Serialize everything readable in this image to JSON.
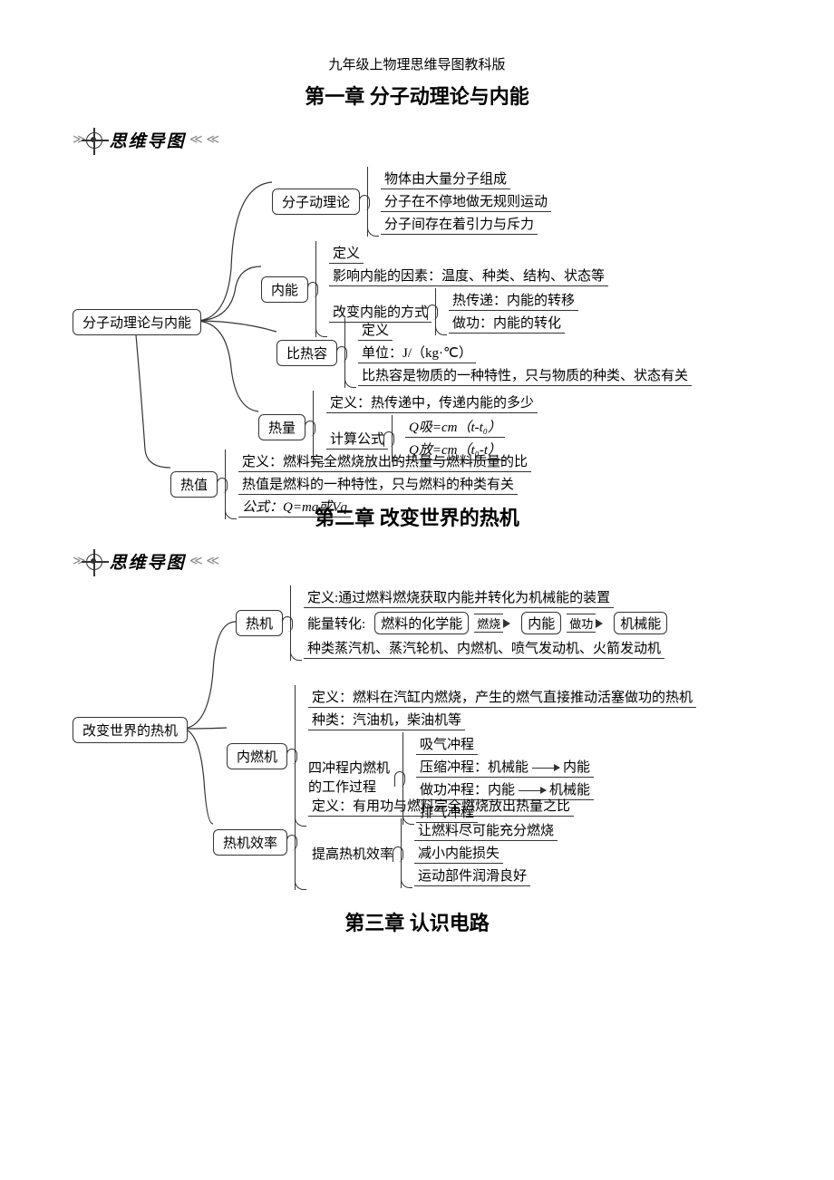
{
  "header": "九年级上物理思维导图教科版",
  "chapter1_title": "第一章 分子动理论与内能",
  "chapter2_title": "第二章 改变世界的热机",
  "chapter3_title": "第三章 认识电路",
  "mindmap_label": "思维导图",
  "map1": {
    "root": "分子动理论与内能",
    "b1": {
      "name": "分子动理论",
      "leaves": [
        "物体由大量分子组成",
        "分子在不停地做无规则运动",
        "分子间存在着引力与斥力"
      ]
    },
    "b2": {
      "name": "内能",
      "l1": "定义",
      "l2": "影响内能的因素：温度、种类、结构、状态等",
      "l3_label": "改变内能的方式",
      "l3a": "热传递：内能的转移",
      "l3b": "做功：内能的转化"
    },
    "b3": {
      "name": "比热容",
      "l1": "定义",
      "l2": "单位：J/（kg·℃）",
      "l3": "比热容是物质的一种特性，只与物质的种类、状态有关"
    },
    "b4": {
      "name": "热量",
      "l1": "定义：热传递中，传递内能的多少",
      "l2_label": "计算公式",
      "l2a": "Q吸=cm（t-t₀）",
      "l2b": "Q放=cm（t₀-t）"
    },
    "b5": {
      "name": "热值",
      "l1": "定义：燃料完全燃烧放出的热量与燃料质量的比",
      "l2": "热值是燃料的一种特性，只与燃料的种类有关",
      "l3": "公式：Q=mq或Vq"
    }
  },
  "map2": {
    "root": "改变世界的热机",
    "b1": {
      "name": "热机",
      "l1": "定义:通过燃料燃烧获取内能并转化为机械能的装置",
      "l2_label": "能量转化:",
      "l2_n1": "燃料的化学能",
      "l2_a1": "燃烧",
      "l2_n2": "内能",
      "l2_a2": "做功",
      "l2_n3": "机械能",
      "l3": "种类蒸汽机、蒸汽轮机、内燃机、喷气发动机、火箭发动机"
    },
    "b2": {
      "name": "内燃机",
      "l1": "定义：燃料在汽缸内燃烧，产生的燃气直接推动活塞做功的热机",
      "l2": "种类：汽油机，柴油机等",
      "l3_label": "四冲程内燃机的工作过程",
      "l3a": "吸气冲程",
      "l3b_pre": "压缩冲程：",
      "l3b_from": "机械能",
      "l3b_to": "内能",
      "l3c_pre": "做功冲程：",
      "l3c_from": "内能",
      "l3c_to": "机械能",
      "l3d": "排气冲程"
    },
    "b3": {
      "name": "热机效率",
      "l1": "定义：有用功与燃料完全燃烧放出热量之比",
      "l2_label": "提高热机效率",
      "l2a": "让燃料尽可能充分燃烧",
      "l2b": "减小内能损失",
      "l2c": "运动部件润滑良好"
    }
  }
}
